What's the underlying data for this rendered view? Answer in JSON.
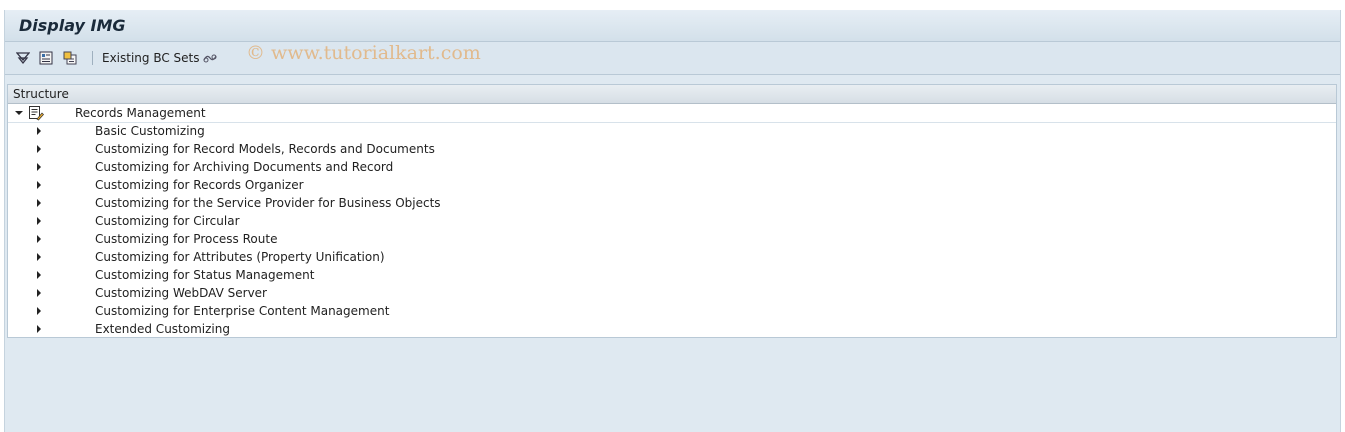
{
  "window": {
    "title": "Display IMG"
  },
  "toolbar": {
    "icons": [
      "expand-subtree-icon",
      "documentation-icon",
      "release-notes-icon",
      "where-used-icon"
    ],
    "existing_bc_sets_label": "Existing BC Sets"
  },
  "watermark": {
    "text": "© www.tutorialkart.com"
  },
  "tree": {
    "column_header": "Structure",
    "root": {
      "label": "Records Management",
      "expanded": true
    },
    "items": [
      {
        "label": "Basic Customizing"
      },
      {
        "label": "Customizing for Record Models, Records and Documents"
      },
      {
        "label": "Customizing for Archiving Documents and Record"
      },
      {
        "label": "Customizing for Records Organizer"
      },
      {
        "label": "Customizing for the Service Provider for Business Objects"
      },
      {
        "label": "Customizing for Circular"
      },
      {
        "label": "Customizing for Process Route"
      },
      {
        "label": "Customizing for Attributes (Property Unification)"
      },
      {
        "label": "Customizing for Status Management"
      },
      {
        "label": "Customizing WebDAV Server"
      },
      {
        "label": "Customizing for Enterprise Content Management"
      },
      {
        "label": "Extended Customizing"
      }
    ]
  }
}
